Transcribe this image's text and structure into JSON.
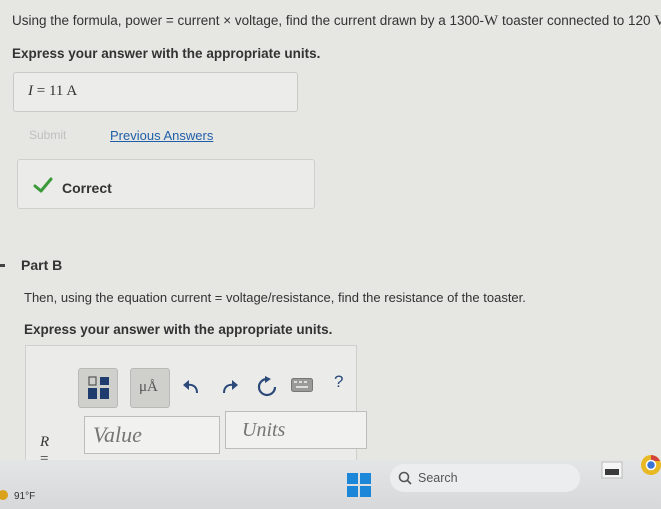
{
  "partA": {
    "question_pre": "Using the formula, power = current × voltage, find the current drawn by a 1300-",
    "question_unit1": "W",
    "question_mid": " toaster connected to 120 ",
    "question_unit2": "V",
    "question_end": ".",
    "instruction": "Express your answer with the appropriate units.",
    "answer_var": "I",
    "answer_eq": " =  11 A",
    "submit_label": "Submit",
    "previous_answers_label": "Previous Answers",
    "feedback_label": "Correct"
  },
  "partB": {
    "title": "Part B",
    "question": "Then, using the equation current = voltage/resistance, find the resistance of the toaster.",
    "instruction": "Express your answer with the appropriate units.",
    "toolbar": {
      "units_button_label": "μÅ",
      "help_label": "?"
    },
    "variable": "R",
    "equals": " =",
    "value_placeholder": "Value",
    "units_placeholder": "Units"
  },
  "taskbar": {
    "temperature": "91°F",
    "search_label": "Search"
  },
  "colors": {
    "link": "#1f5fa8",
    "check": "#3a9a3a",
    "win_logo": "#1c86d9"
  }
}
